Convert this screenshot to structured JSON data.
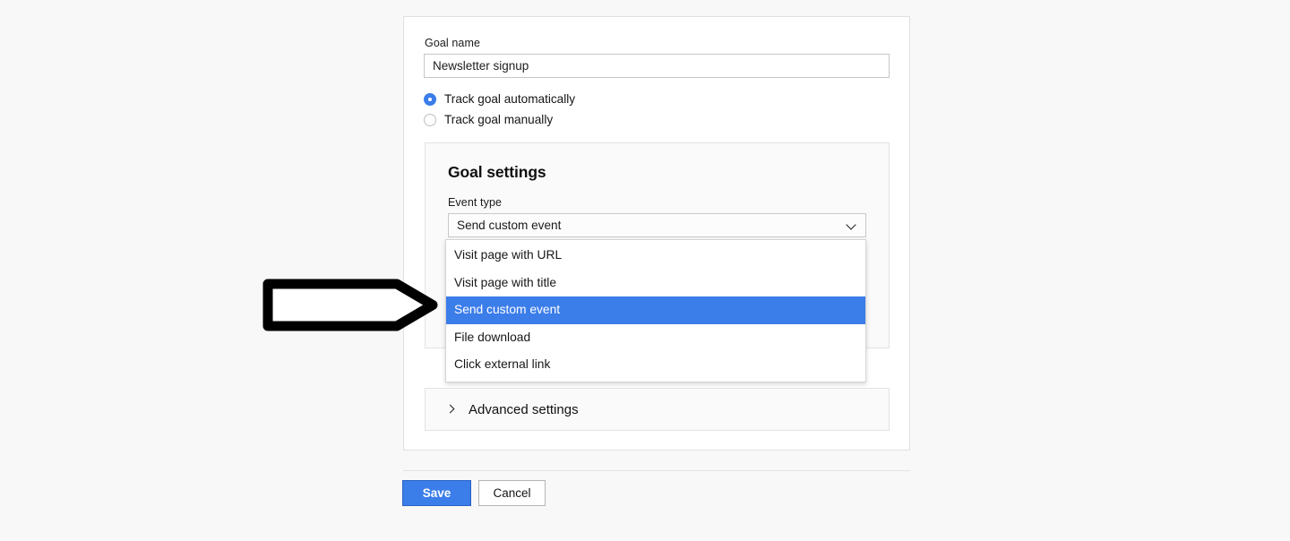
{
  "form": {
    "goal_name": {
      "label": "Goal name",
      "value": "Newsletter signup",
      "placeholder": "Goal name"
    },
    "tracking_mode": {
      "options": [
        {
          "label": "Track goal automatically",
          "selected": true
        },
        {
          "label": "Track goal manually",
          "selected": false
        }
      ]
    },
    "goal_settings": {
      "title": "Goal settings",
      "event_type": {
        "label": "Event type",
        "selected_value": "Send custom event",
        "expanded": true,
        "options": [
          "Visit page with URL",
          "Visit page with title",
          "Send custom event",
          "File download",
          "Click external link"
        ],
        "highlighted_option": "Send custom event"
      },
      "secondary_field_value": ""
    },
    "advanced_settings": {
      "label": "Advanced settings",
      "expanded": false
    }
  },
  "footer": {
    "save_label": "Save",
    "cancel_label": "Cancel"
  },
  "colors": {
    "accent_blue": "#3b7de9",
    "save_border": "#2a63c4",
    "page_background": "#f8f8f8",
    "card_background": "#ffffff",
    "panel_background": "#fafafa",
    "annotation_outline": "#000000"
  },
  "annotation": {
    "type": "arrow",
    "direction": "right",
    "fill": "#ffffff",
    "stroke": "#000000"
  }
}
